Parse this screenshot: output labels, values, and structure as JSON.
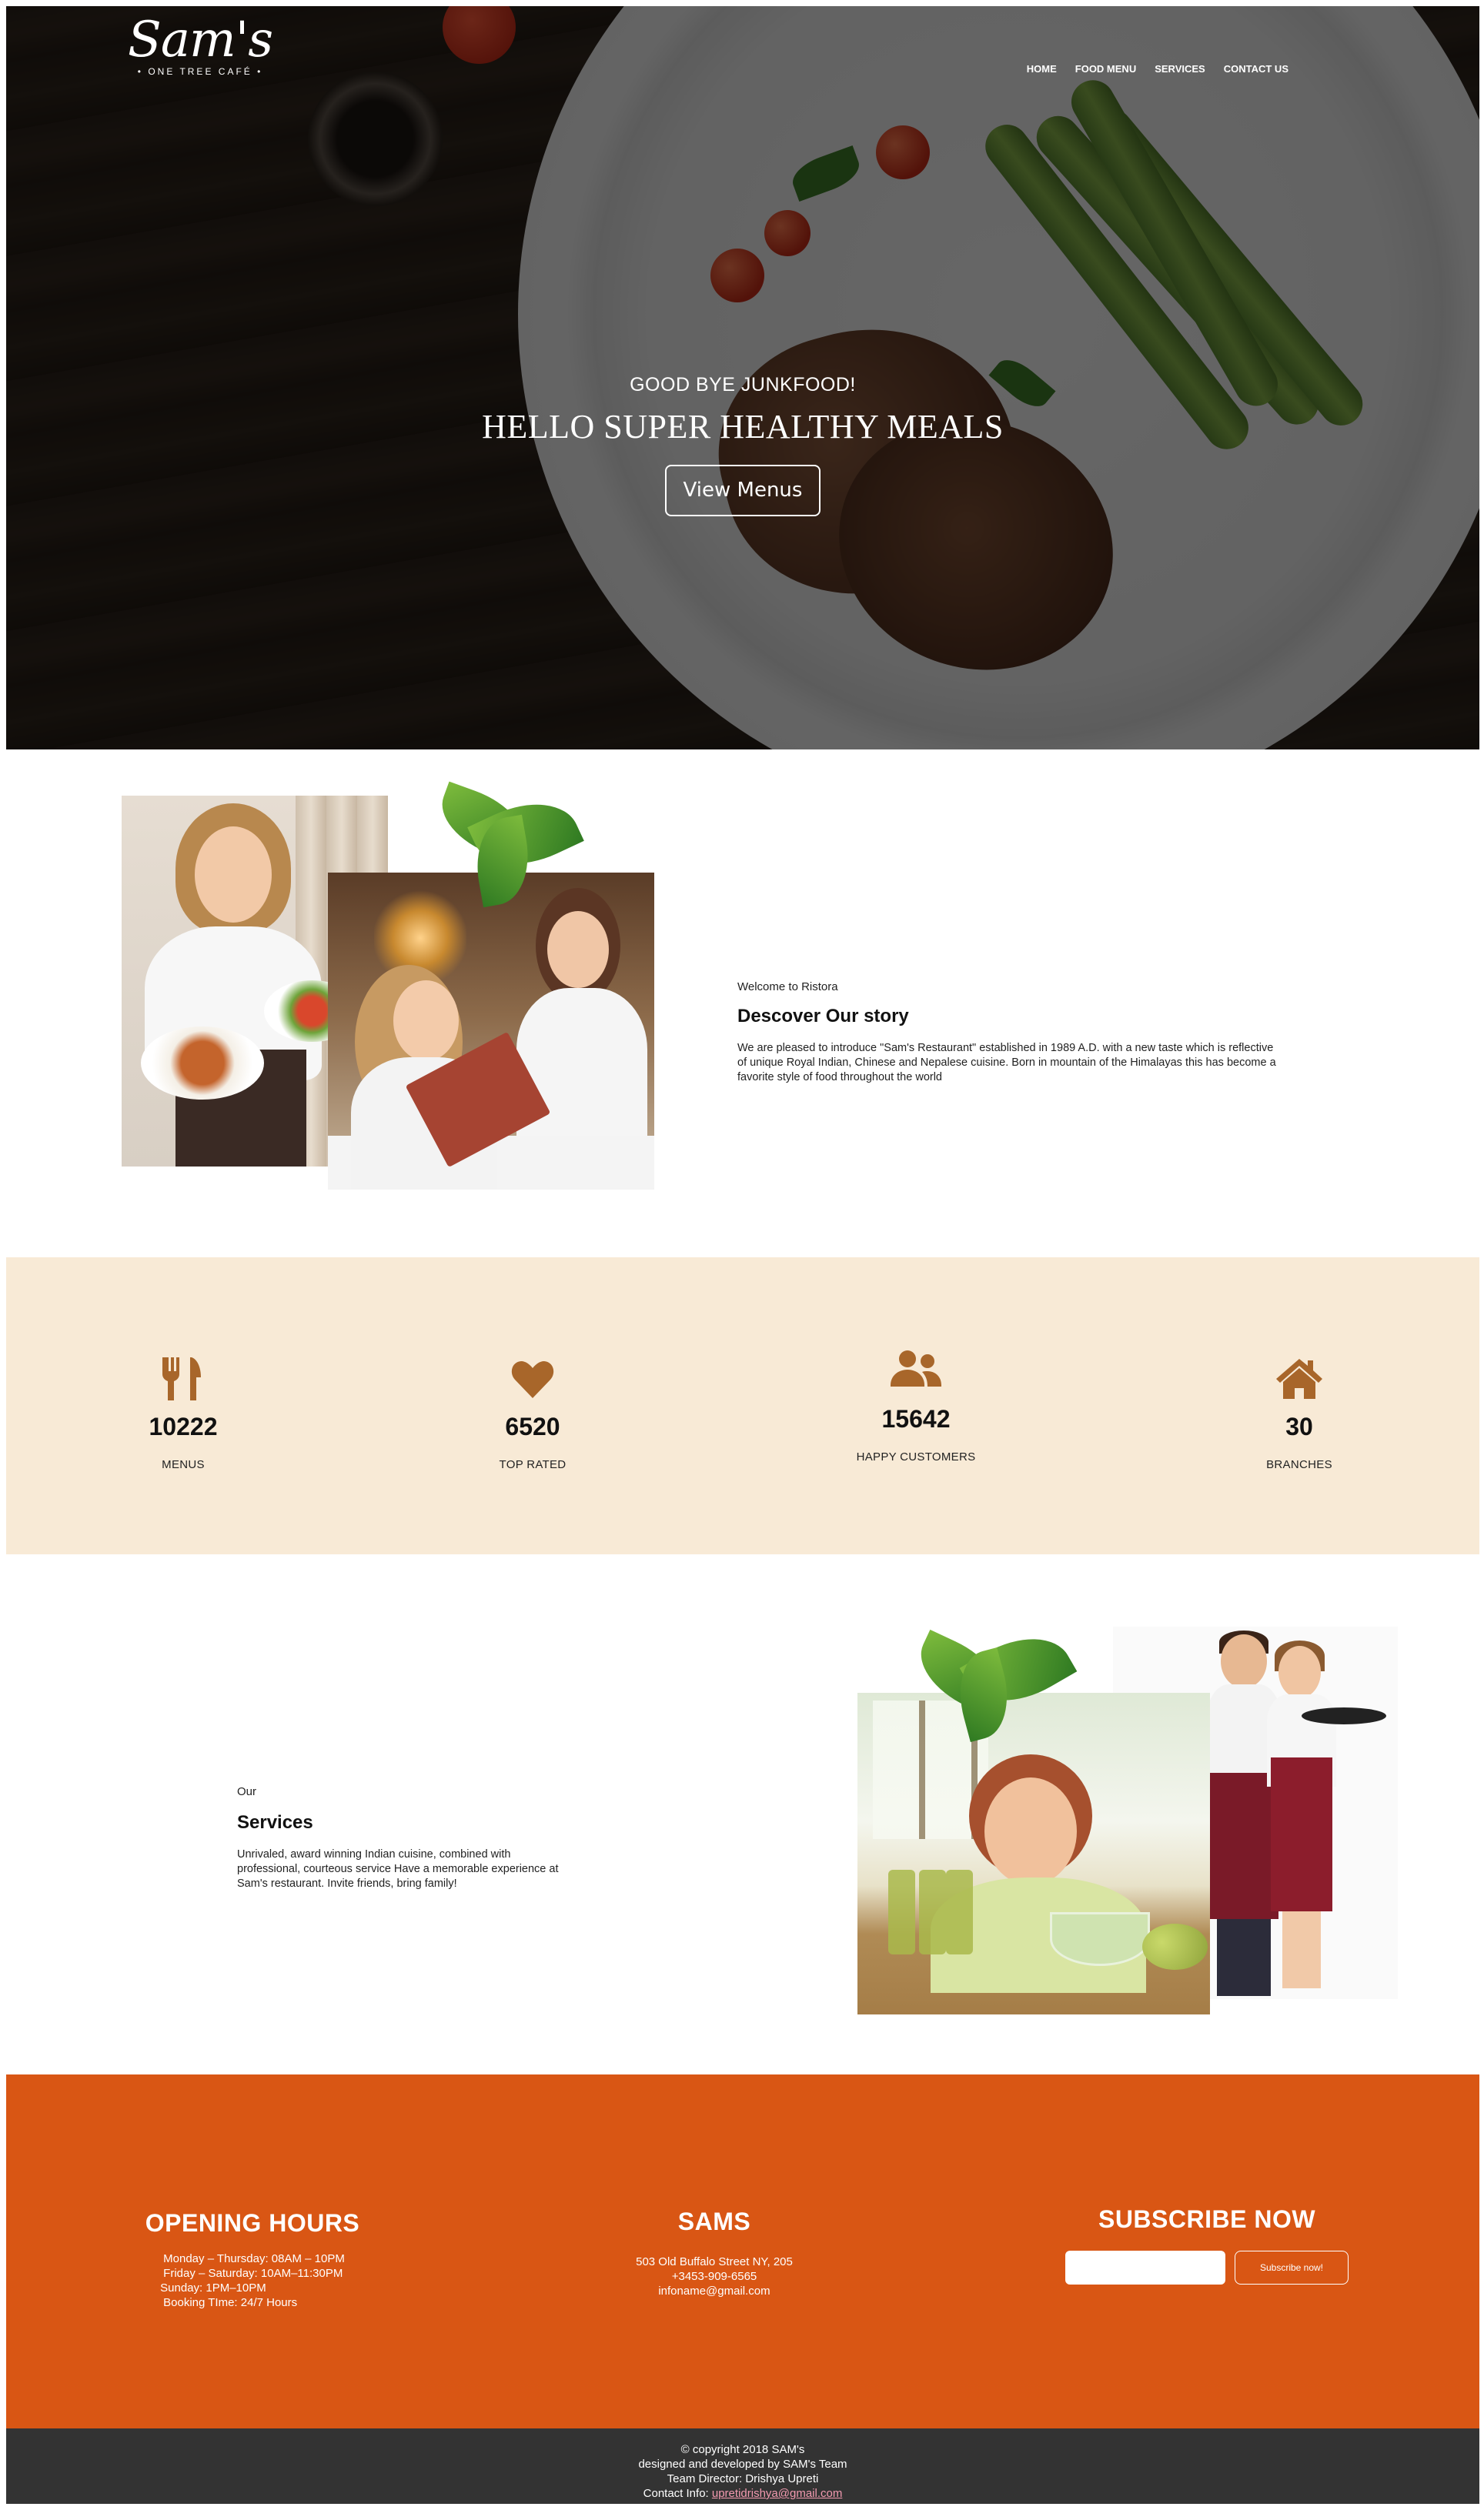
{
  "brand": {
    "logo_main": "Sam's",
    "logo_sub": "• ONE TREE CAFÉ •"
  },
  "nav": {
    "items": [
      {
        "label": "HOME"
      },
      {
        "label": "FOOD MENU"
      },
      {
        "label": "SERVICES"
      },
      {
        "label": "CONTACT US"
      }
    ]
  },
  "hero": {
    "kicker": "GOOD BYE JUNKFOOD!",
    "title": "HELLO SUPER HEALTHY MEALS",
    "button_label": "View Menus"
  },
  "story": {
    "kicker": "Welcome to Ristora",
    "heading": "Descover Our story",
    "body": "We are pleased to introduce \"Sam's Restaurant\" established in 1989 A.D. with a new taste which is reflective of unique Royal Indian, Chinese and Nepalese cuisine. Born in mountain of the Himalayas this has become a favorite style of food throughout the world"
  },
  "stats": {
    "icon_color": "#a8662a",
    "items": [
      {
        "icon": "fork-knife-icon",
        "value": "10222",
        "label": "MENUS"
      },
      {
        "icon": "heart-icon",
        "value": "6520",
        "label": "TOP RATED"
      },
      {
        "icon": "users-icon",
        "value": "15642",
        "label": "HAPPY CUSTOMERS"
      },
      {
        "icon": "home-icon",
        "value": "30",
        "label": "BRANCHES"
      }
    ]
  },
  "services": {
    "kicker": "Our",
    "heading": "Services",
    "body": "Unrivaled, award winning Indian cuisine, combined with professional, courteous service Have a memorable experience at Sam's restaurant. Invite friends, bring family!"
  },
  "footer": {
    "background": "#d95614",
    "hours": {
      "heading": "OPENING HOURS",
      "lines": [
        "Monday – Thursday: 08AM – 10PM",
        "Friday – Saturday: 10AM–11:30PM",
        "Sunday: 1PM–10PM",
        "Booking TIme: 24/7 Hours"
      ]
    },
    "contact": {
      "heading": "SAMS",
      "address": "503 Old Buffalo Street NY, 205",
      "phone": "+3453-909-6565",
      "email": "infoname@gmail.com"
    },
    "subscribe": {
      "heading": "SUBSCRIBE NOW",
      "input_value": "",
      "button_label": "Subscribe now!"
    }
  },
  "copyright": {
    "line1": "© copyright 2018 SAM's",
    "line2": "designed and developed by SAM's Team",
    "line3": "Team Director: Drishya Upreti",
    "contact_prefix": "Contact Info: ",
    "contact_email": "upretidrishya@gmail.com"
  }
}
